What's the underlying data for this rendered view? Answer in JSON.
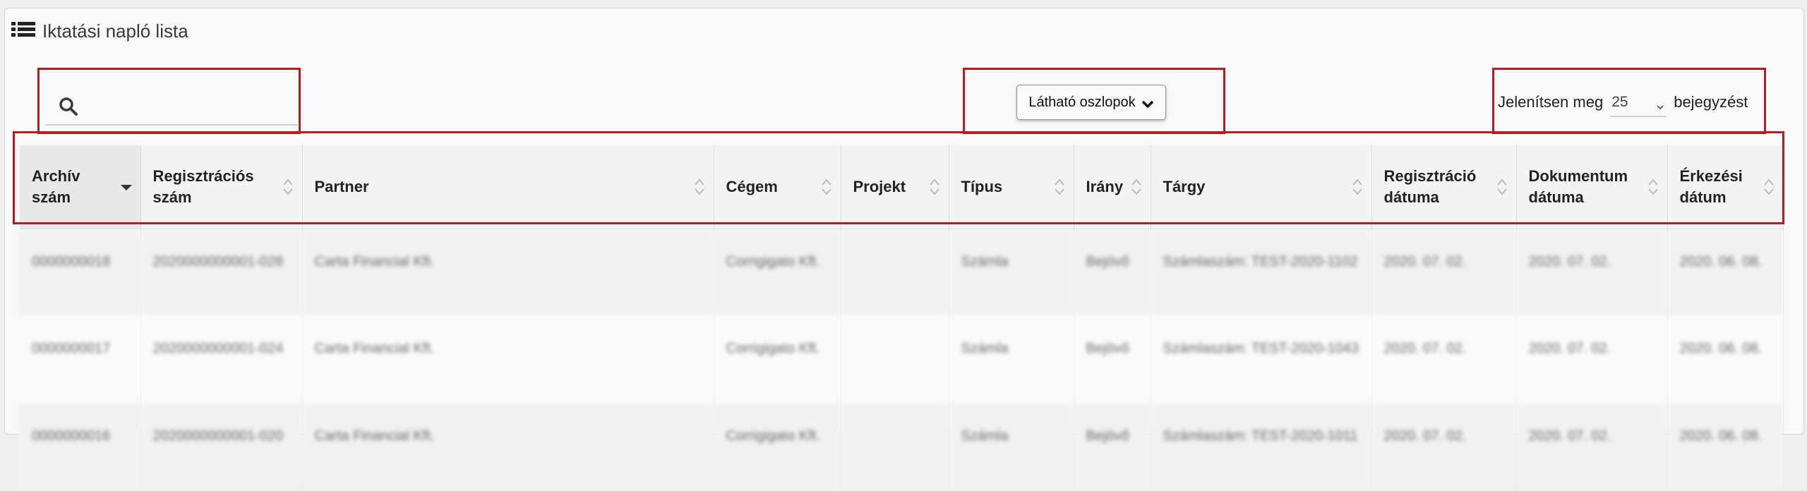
{
  "title": "Iktatási napló lista",
  "search": {
    "value": "",
    "placeholder": ""
  },
  "columns_button": {
    "label": "Látható oszlopok"
  },
  "page_length": {
    "prefix": "Jelenítsen meg",
    "value": "25",
    "suffix": "bejegyzést"
  },
  "table": {
    "headers": [
      {
        "line1": "Archív",
        "line2": "szám",
        "sorted": "desc"
      },
      {
        "line1": "Regisztrációs",
        "line2": "szám"
      },
      {
        "line1": "Partner",
        "line2": ""
      },
      {
        "line1": "Cégem",
        "line2": ""
      },
      {
        "line1": "Projekt",
        "line2": ""
      },
      {
        "line1": "Típus",
        "line2": ""
      },
      {
        "line1": "Irány",
        "line2": ""
      },
      {
        "line1": "Tárgy",
        "line2": ""
      },
      {
        "line1": "Regisztráció",
        "line2": "dátuma"
      },
      {
        "line1": "Dokumentum",
        "line2": "dátuma"
      },
      {
        "line1": "Érkezési",
        "line2": "dátum"
      }
    ],
    "rows": [
      [
        "0000000018",
        "2020000000001-028",
        "Carta Financial Kft.",
        "Corrigigato Kft.",
        "",
        "Számla",
        "Bejövő",
        "Számlaszám: TEST-2020-1102",
        "2020. 07. 02.",
        "2020. 07. 02.",
        "2020. 06. 08."
      ],
      [
        "0000000017",
        "2020000000001-024",
        "Carta Financial Kft.",
        "Corrigigato Kft.",
        "",
        "Számla",
        "Bejövő",
        "Számlaszám: TEST-2020-1043",
        "2020. 07. 02.",
        "2020. 07. 02.",
        "2020. 06. 08."
      ],
      [
        "0000000016",
        "2020000000001-020",
        "Carta Financial Kft.",
        "Corrigigato Kft.",
        "",
        "Számla",
        "Bejövő",
        "Számlaszám: TEST-2020-1011",
        "2020. 07. 02.",
        "2020. 07. 02.",
        "2020. 06. 08."
      ]
    ]
  },
  "colors": {
    "highlight_border": "#b51d21",
    "header_bg": "#f3f3f3"
  }
}
